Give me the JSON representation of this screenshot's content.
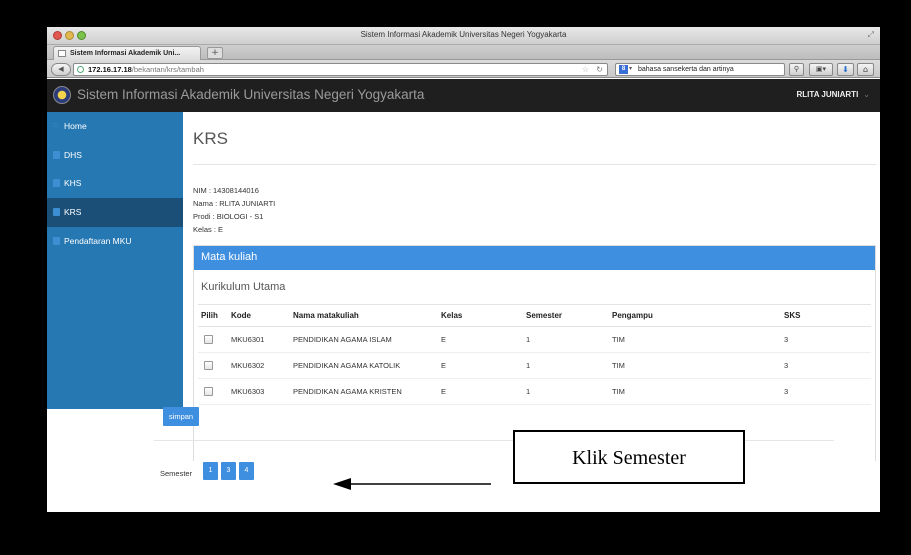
{
  "browser": {
    "window_title": "Sistem Informasi Akademik Universitas Negeri Yogyakarta",
    "tab_title": "Sistem Informasi Akademik Uni...",
    "new_tab_label": "+",
    "url_host": "172.16.17.18",
    "url_path": "/bekantan/krs/tambah",
    "search_text": "bahasa sansekerta dan artinya",
    "icons": [
      "back-icon",
      "globe-icon",
      "star-icon",
      "reload-icon",
      "search-engine-icon",
      "magnifier-icon",
      "bookmarks-icon",
      "download-icon",
      "home-icon"
    ]
  },
  "site": {
    "title": "Sistem Informasi Akademik Universitas Negeri Yogyakarta",
    "user": "RLITA JUNIARTI",
    "user_caret": "⌄"
  },
  "sidebar": {
    "items": [
      {
        "label": "Home",
        "icon": "home-icon",
        "active": false
      },
      {
        "label": "DHS",
        "icon": "document-icon",
        "active": false
      },
      {
        "label": "KHS",
        "icon": "document-icon",
        "active": false
      },
      {
        "label": "KRS",
        "icon": "document-icon",
        "active": true
      },
      {
        "label": "Pendaftaran MKU",
        "icon": "document-icon",
        "active": false
      }
    ]
  },
  "main": {
    "heading": "KRS",
    "nim": "NIM   : 14308144016",
    "nama": "Nama : RLITA JUNIARTI",
    "prodi": "Prodi : BIOLOGI - S1",
    "kelas": "Kelas : E",
    "panel_title": "Mata kuliah",
    "subheading": "Kurikulum Utama",
    "table": {
      "headers": [
        "Pilih",
        "Kode",
        "Nama matakuliah",
        "Kelas",
        "Semester",
        "Pengampu",
        "SKS"
      ],
      "rows": [
        [
          "MKU6301",
          "PENDIDIKAN AGAMA ISLAM",
          "E",
          "1",
          "TIM",
          "3"
        ],
        [
          "MKU6302",
          "PENDIDIKAN AGAMA KATOLIK",
          "E",
          "1",
          "TIM",
          "3"
        ],
        [
          "MKU6303",
          "PENDIDIKAN AGAMA KRISTEN",
          "E",
          "1",
          "TIM",
          "3"
        ]
      ]
    },
    "save_label": "simpan",
    "semester_label": "Semester",
    "semester_buttons": [
      "1",
      "3",
      "4"
    ]
  },
  "annotation": {
    "callout_text": "Klik Semester"
  },
  "colors": {
    "navbar": "#1f1f1f",
    "sidebar": "#2678b2",
    "sidebar_active": "#1b4f77",
    "accent": "#3f8fe0"
  }
}
